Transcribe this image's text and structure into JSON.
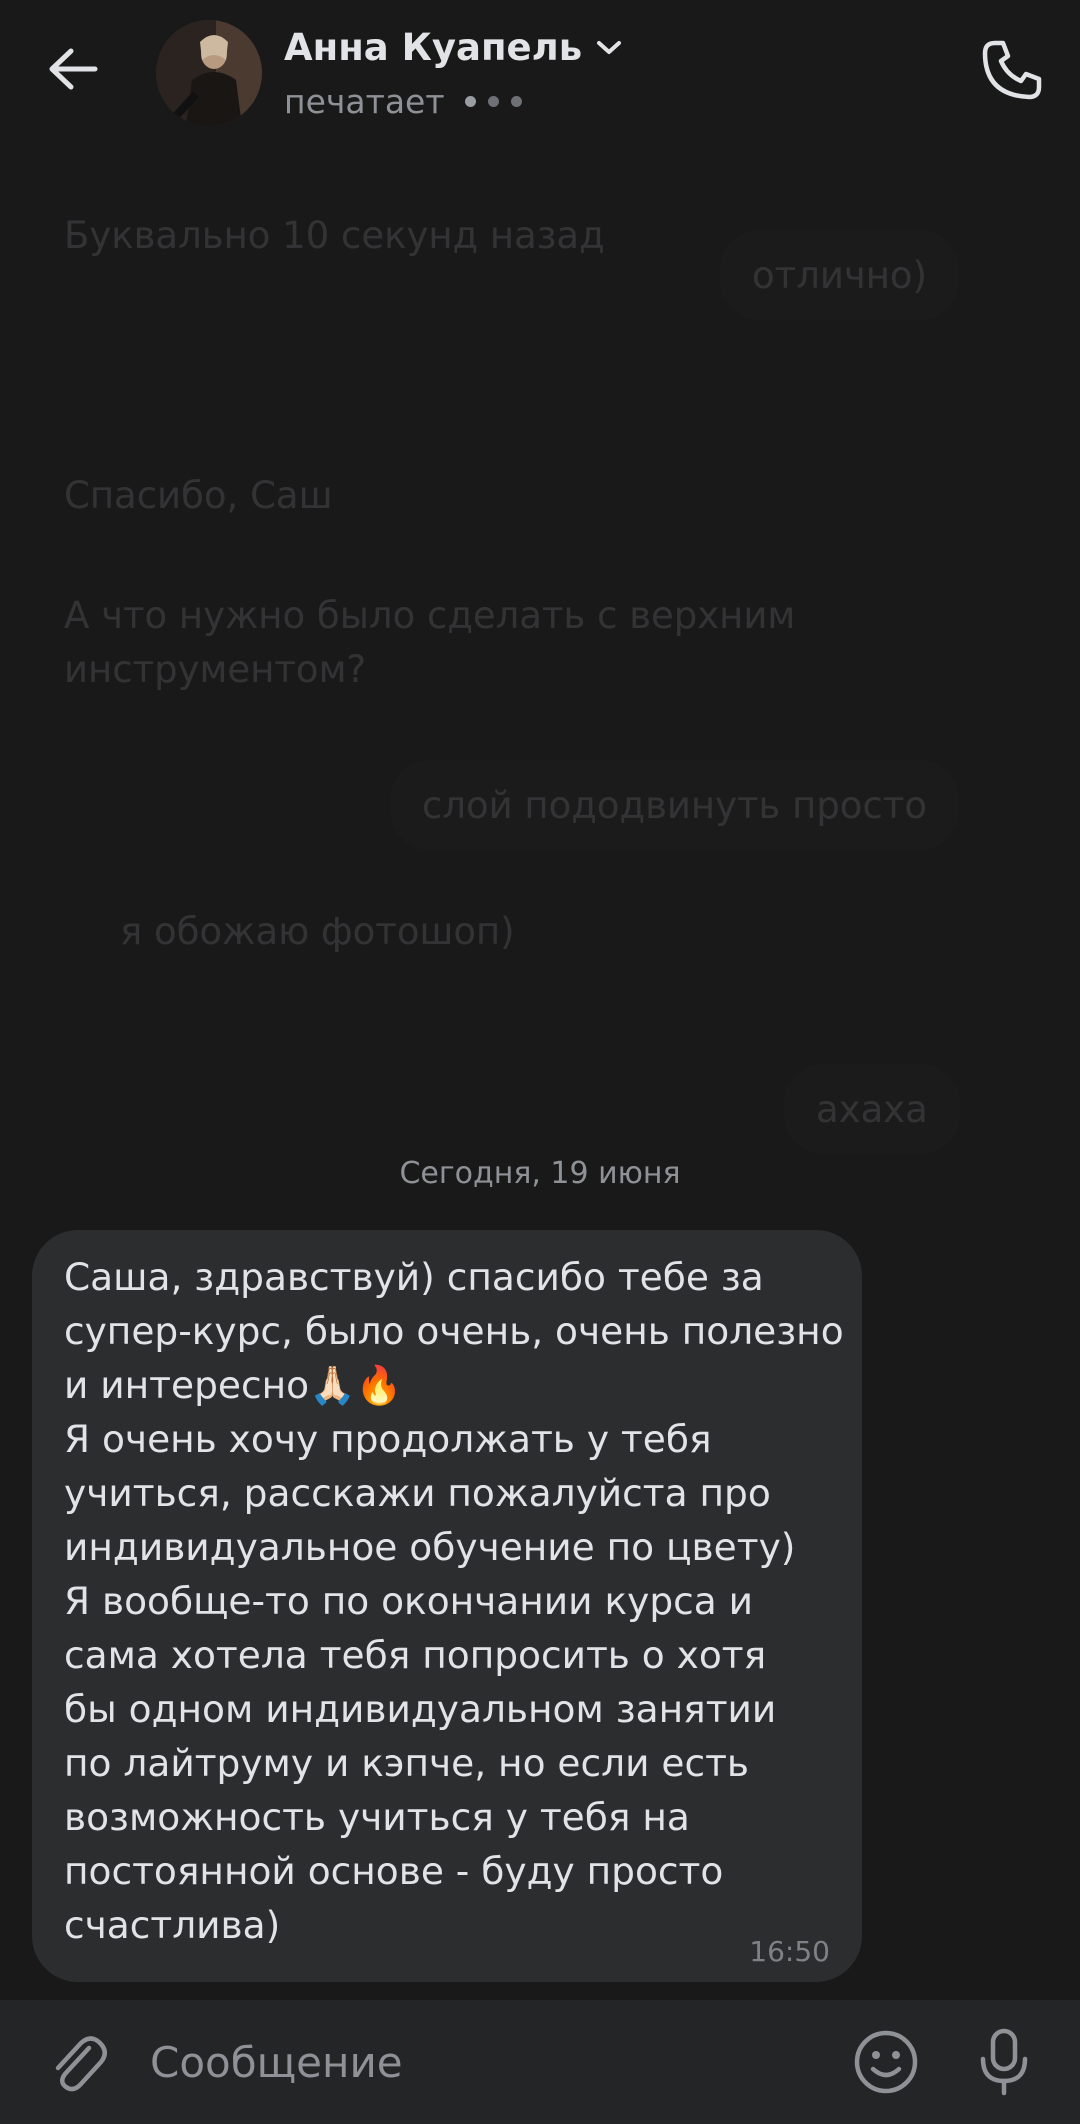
{
  "header": {
    "contact_name": "Анна Куапель",
    "status": "печатает"
  },
  "history": {
    "msg1": "Буквально 10 секунд назад",
    "msg2": "отлично)",
    "msg3": "Спасибо, Саш",
    "msg4_line1": "А что нужно было сделать с верхним",
    "msg4_line2": "инструментом?",
    "msg5": "слой пододвинуть просто",
    "msg6": "я обожаю фотошоп)",
    "msg7": "ахаха"
  },
  "date_separator": "Сегодня, 19 июня",
  "message": {
    "text": "Саша, здравствуй) спасибо тебе за\nсупер-курс, было очень, очень полезно\nи интересно🙏🏻🔥\nЯ очень хочу продолжать у тебя\nучиться, расскажи пожалуйста про\nиндивидуальное обучение по цвету)\nЯ вообще-то по окончании курса и\nсама хотела тебя попросить о хотя\nбы одном индивидуальном занятии\nпо лайтруму и кэпче, но если есть\nвозможность учиться у тебя на\nпостоянной основе - буду просто\nсчастлива)",
    "time": "16:50"
  },
  "composer": {
    "placeholder": "Сообщение"
  },
  "icons": {
    "back": "arrow-left-icon",
    "call": "phone-icon",
    "attach": "paperclip-icon",
    "emoji": "smile-icon",
    "mic": "microphone-icon"
  },
  "colors": {
    "background": "#19191a",
    "bubble": "#2c2d2f",
    "composer": "#242527",
    "text": "#e1e3e6",
    "secondary": "#8e9196"
  }
}
